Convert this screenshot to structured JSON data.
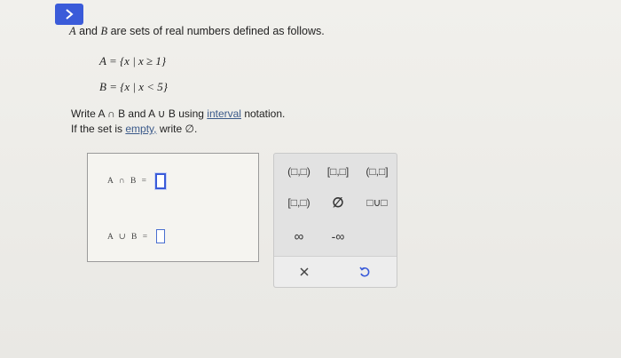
{
  "header": {
    "collapse_icon": "chevron-right-icon",
    "accent": "#3a5bd9"
  },
  "problem": {
    "intro_a": "A",
    "intro_and": "and",
    "intro_b": "B",
    "intro_rest": "are sets of real numbers defined as follows.",
    "set_a": "A = {x | x ≥ 1}",
    "set_b": "B = {x | x < 5}",
    "instruction_1": "Write A ∩ B and A ∪ B using",
    "instruction_link": "interval",
    "instruction_1_end": "notation.",
    "instruction_2_start": "If the set is",
    "instruction_2_link": "empty,",
    "instruction_2_end": "write ∅."
  },
  "answers": {
    "intersection_label": "A ∩ B =",
    "union_label": "A ∪ B ="
  },
  "keypad": {
    "open_open": "(□,□)",
    "closed_closed": "[□,□]",
    "open_closed": "(□,□]",
    "closed_open": "[□,□)",
    "empty_set": "∅",
    "union": "□∪□",
    "infinity": "∞",
    "neg_infinity": "-∞",
    "clear_icon": "x-icon",
    "undo_icon": "undo-icon"
  }
}
